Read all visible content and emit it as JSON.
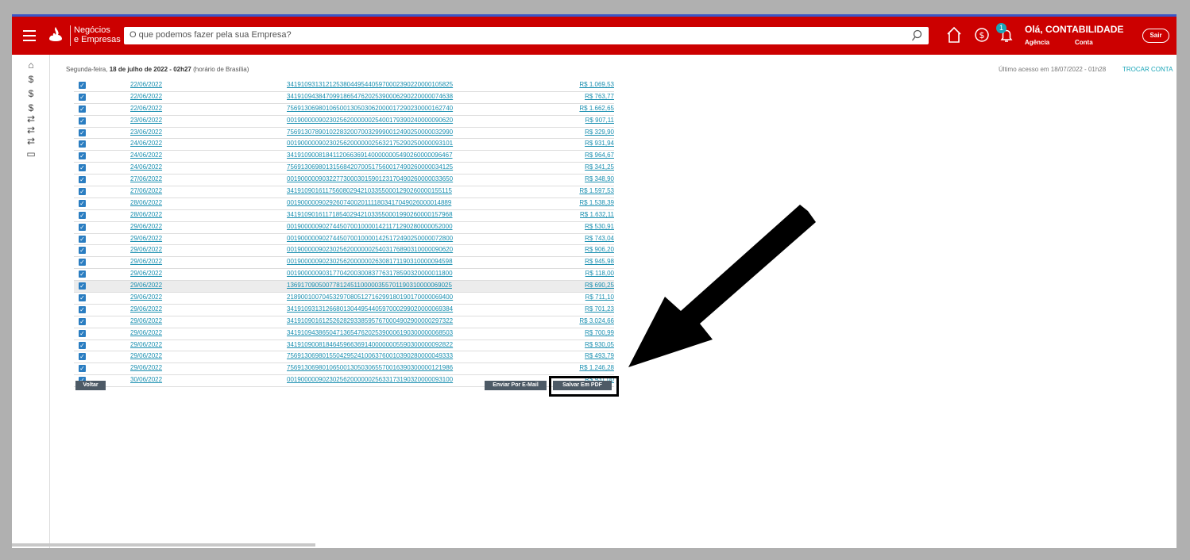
{
  "header": {
    "brand_line1": "Negócios",
    "brand_line2": "e Empresas",
    "search_placeholder": "O que podemos fazer pela sua Empresa?",
    "notification_count": "1",
    "greeting": "Olá, CONTABILIDADE",
    "agencia_label": "Agência",
    "conta_label": "Conta",
    "logout_label": "Sair",
    "colors": {
      "bar": "#cc0000",
      "accent": "#1aa5b8"
    }
  },
  "sidebar": {
    "icons": [
      "home-icon",
      "money-refresh-icon",
      "money-refresh-icon",
      "dollar-icon",
      "transfer-icon",
      "transfer-icon",
      "transfer-icon",
      "card-icon"
    ]
  },
  "info": {
    "weekday": "Segunda-feira,",
    "date_bold": "18 de julho de 2022 - 02h27",
    "tz": "(horário de Brasília)",
    "last_access": "Último acesso em  18/07/2022 - 01h28",
    "switch_account": "TROCAR CONTA"
  },
  "rows": [
    {
      "date": "22/06/2022",
      "code": "34191093131212538044954405970002390220000105825",
      "value": "R$ 1.069,53"
    },
    {
      "date": "22/06/2022",
      "code": "34191094384709918654762025390006290220000074638",
      "value": "R$ 763,77"
    },
    {
      "date": "22/06/2022",
      "code": "75691306980106500130503062000017290230000162740",
      "value": "R$ 1.662,65"
    },
    {
      "date": "23/06/2022",
      "code": "00190000090230256200000025400179390240000090620",
      "value": "R$ 907,11"
    },
    {
      "date": "23/06/2022",
      "code": "75691307890102283200700329990012490250000032990",
      "value": "R$ 329,90"
    },
    {
      "date": "24/06/2022",
      "code": "00190000090230256200000025632175290250000093101",
      "value": "R$ 931,94"
    },
    {
      "date": "24/06/2022",
      "code": "34191090081841120663691400000005490260000096467",
      "value": "R$ 964,67"
    },
    {
      "date": "24/06/2022",
      "code": "75691306980131568420700517560017490260000034125",
      "value": "R$ 341,25"
    },
    {
      "date": "27/06/2022",
      "code": "00190000090322773000301590123170490260000033650",
      "value": "R$ 348,90"
    },
    {
      "date": "27/06/2022",
      "code": "34191090161175608029421033550001290260000155115",
      "value": "R$ 1.597,53"
    },
    {
      "date": "28/06/2022",
      "code": "00190000090292607400201111803417049026000014889",
      "value": "R$ 1.538,39"
    },
    {
      "date": "28/06/2022",
      "code": "34191090161171854029421033550001990260000157968",
      "value": "R$ 1.632,11"
    },
    {
      "date": "29/06/2022",
      "code": "00190000090274450700100001421171290280000052000",
      "value": "R$ 530,91"
    },
    {
      "date": "29/06/2022",
      "code": "00190000090274450700100001425172490250000072800",
      "value": "R$ 743,04"
    },
    {
      "date": "29/06/2022",
      "code": "00190000090230256200000025403176890310000090620",
      "value": "R$ 906,20"
    },
    {
      "date": "29/06/2022",
      "code": "00190000090230256200000026308171190310000094598",
      "value": "R$ 945,98"
    },
    {
      "date": "29/06/2022",
      "code": "00190000090317704200300837763178590320000011800",
      "value": "R$ 118,00"
    },
    {
      "date": "29/06/2022",
      "code": "13691709050077812451100000355701190310000069025",
      "value": "R$ 690,25"
    },
    {
      "date": "29/06/2022",
      "code": "21890010070453297080512716299180190170000069400",
      "value": "R$ 711,10"
    },
    {
      "date": "29/06/2022",
      "code": "34191093131266801304495440597000299020000069384",
      "value": "R$ 701,23"
    },
    {
      "date": "29/06/2022",
      "code": "34191090161252628293385957670004902900000297322",
      "value": "R$ 3.024,66"
    },
    {
      "date": "29/06/2022",
      "code": "34191094386504713654762025390006190300000068503",
      "value": "R$ 700,99"
    },
    {
      "date": "29/06/2022",
      "code": "34191090081846459663691400000005590300000092822",
      "value": "R$ 930,05"
    },
    {
      "date": "29/06/2022",
      "code": "75691306980155042952410063760010390280000049333",
      "value": "R$ 493,79"
    },
    {
      "date": "29/06/2022",
      "code": "75691306980106500130503065570016390300000121986",
      "value": "R$ 1.246,28"
    },
    {
      "date": "30/06/2022",
      "code": "00190000090230256200000025633173190320000093100",
      "value": "R$ 931,00"
    }
  ],
  "buttons": {
    "back": "Voltar",
    "email": "Enviar Por E-Mail",
    "pdf": "Salvar Em PDF"
  }
}
